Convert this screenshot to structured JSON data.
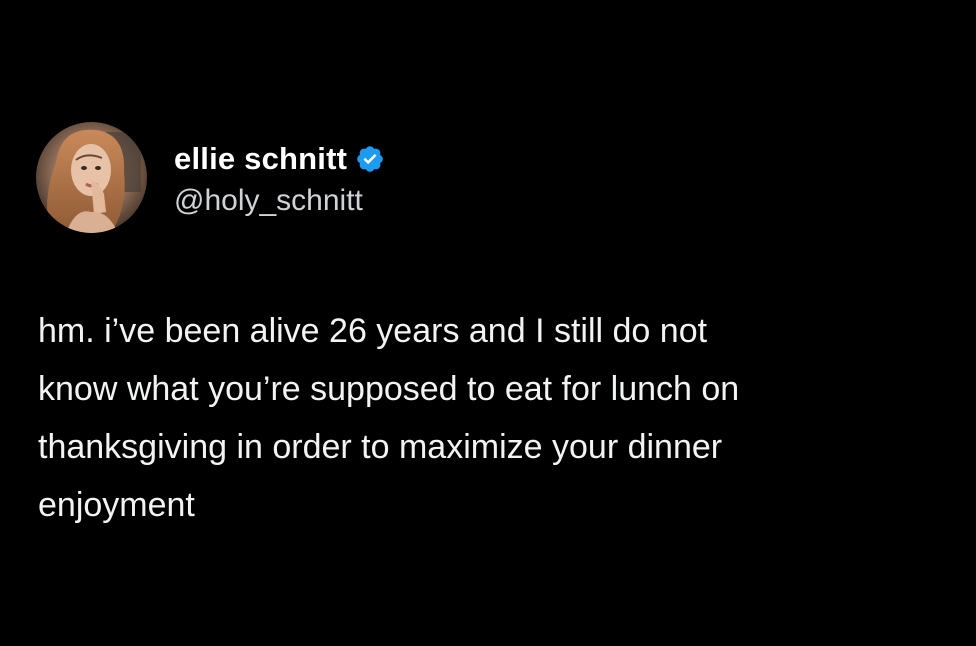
{
  "author": {
    "display_name": "ellie schnitt",
    "handle": "@holy_schnitt",
    "verified": true,
    "verified_icon": "verified-badge-icon",
    "verified_color": "#1d9bf0",
    "avatar_icon": "profile-photo"
  },
  "tweet": {
    "text": "hm. i’ve been alive 26 years and I still do not\nknow what you’re supposed to eat for lunch on\nthanksgiving in order to maximize your dinner\nenjoyment"
  },
  "theme": {
    "background": "#000000",
    "text": "#ffffff"
  }
}
